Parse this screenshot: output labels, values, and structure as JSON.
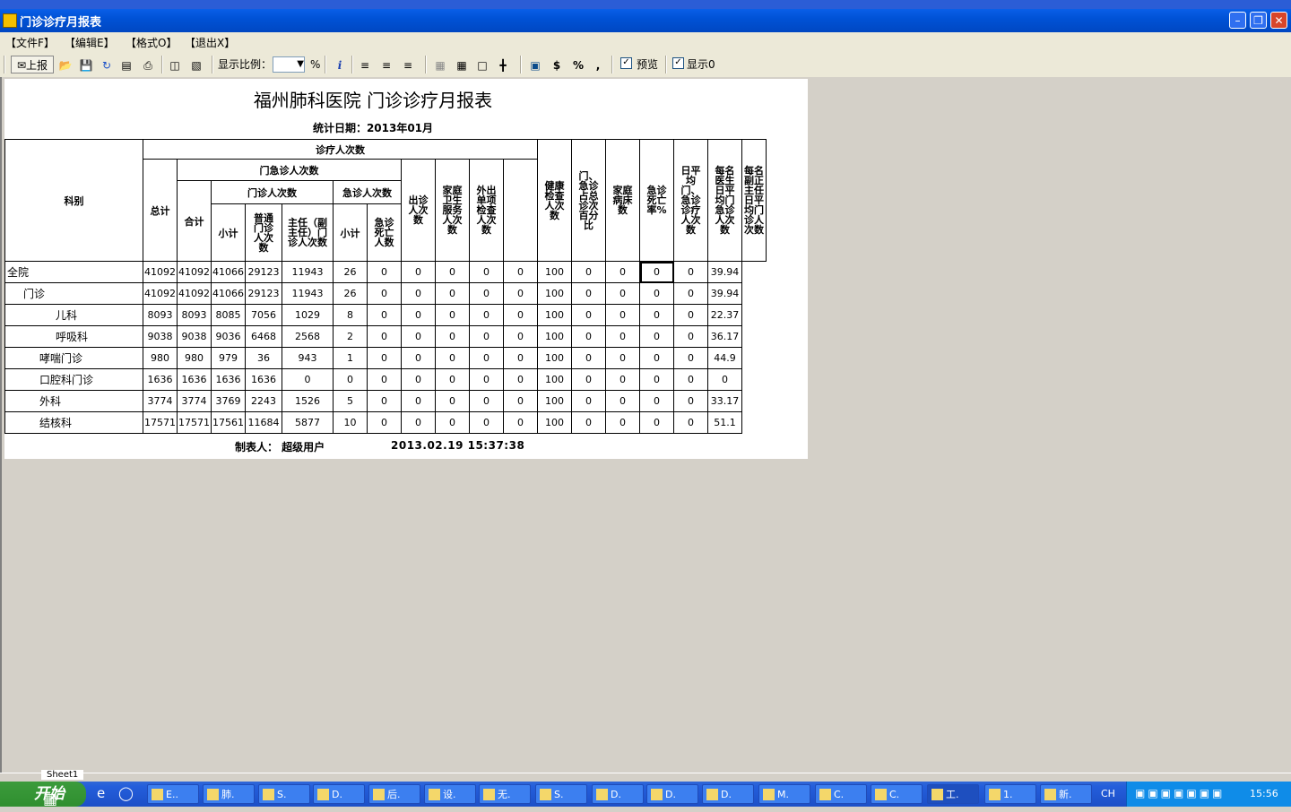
{
  "window": {
    "title": "门诊诊疗月报表"
  },
  "menu": {
    "file": "【文件F】",
    "edit": "【编辑E】",
    "format": "【格式O】",
    "exit": "【退出X】"
  },
  "toolbar": {
    "report": "上报",
    "zoom_label": "显示比例：",
    "zoom_value": "",
    "percent": "%",
    "preview": "预览",
    "show": "显示0",
    "dollar": "$",
    "pct": "%",
    "comma": ","
  },
  "report": {
    "title": "福州肺科医院  门诊诊疗月报表",
    "date": "统计日期：2013年01月",
    "headers": {
      "dept": "科别",
      "visits": "诊疗人次数",
      "total": "总计",
      "oe": "门急诊人次数",
      "oe_total": "合计",
      "outpatient": "门诊人次数",
      "op_sub": "小计",
      "op_general": "普通门诊人次数",
      "op_director": "主任（副主任）门诊人次数",
      "emergency": "急诊人次数",
      "em_sub": "小计",
      "em_death": "急诊死亡人数",
      "house_call": "出诊人次数",
      "family_service": "家庭卫生服务人次数",
      "external_exam": "外出单项检查人次数",
      "health_check": "健康检查人次数",
      "oe_ratio": "门、急诊占总诊次百分比",
      "family_beds": "家庭病床数",
      "em_death_rate": "急诊死亡率%",
      "daily_avg": "日平均门、急诊诊疗人次数",
      "doctor_daily": "每名医生日平均门急诊人次数",
      "director_daily": "每名副正主任日平均门诊人次数"
    },
    "rows": [
      {
        "name": "全院",
        "indent": 0,
        "v": [
          "41092",
          "41092",
          "41066",
          "29123",
          "11943",
          "26",
          "0",
          "0",
          "0",
          "0",
          "0",
          "100",
          "0",
          "0",
          "0",
          "0",
          "39.94"
        ]
      },
      {
        "name": "门诊",
        "indent": 1,
        "v": [
          "41092",
          "41092",
          "41066",
          "29123",
          "11943",
          "26",
          "0",
          "0",
          "0",
          "0",
          "0",
          "100",
          "0",
          "0",
          "0",
          "0",
          "39.94"
        ]
      },
      {
        "name": "儿科",
        "indent": 3,
        "v": [
          "8093",
          "8093",
          "8085",
          "7056",
          "1029",
          "8",
          "0",
          "0",
          "0",
          "0",
          "0",
          "100",
          "0",
          "0",
          "0",
          "0",
          "22.37"
        ]
      },
      {
        "name": "呼吸科",
        "indent": 3,
        "v": [
          "9038",
          "9038",
          "9036",
          "6468",
          "2568",
          "2",
          "0",
          "0",
          "0",
          "0",
          "0",
          "100",
          "0",
          "0",
          "0",
          "0",
          "36.17"
        ]
      },
      {
        "name": "哮喘门诊",
        "indent": 2,
        "v": [
          "980",
          "980",
          "979",
          "36",
          "943",
          "1",
          "0",
          "0",
          "0",
          "0",
          "0",
          "100",
          "0",
          "0",
          "0",
          "0",
          "44.9"
        ]
      },
      {
        "name": "口腔科门诊",
        "indent": 2,
        "v": [
          "1636",
          "1636",
          "1636",
          "1636",
          "0",
          "0",
          "0",
          "0",
          "0",
          "0",
          "0",
          "100",
          "0",
          "0",
          "0",
          "0",
          "0"
        ]
      },
      {
        "name": "外科",
        "indent": 2,
        "v": [
          "3774",
          "3774",
          "3769",
          "2243",
          "1526",
          "5",
          "0",
          "0",
          "0",
          "0",
          "0",
          "100",
          "0",
          "0",
          "0",
          "0",
          "33.17"
        ]
      },
      {
        "name": "结核科",
        "indent": 2,
        "v": [
          "17571",
          "17571",
          "17561",
          "11684",
          "5877",
          "10",
          "0",
          "0",
          "0",
          "0",
          "0",
          "100",
          "0",
          "0",
          "0",
          "0",
          "51.1"
        ]
      }
    ],
    "footer_maker": "制表人： 超级用户",
    "footer_time": "2013.02.19  15:37:38"
  },
  "sheet_tab": "Sheet1",
  "taskbar": {
    "start": "开始",
    "tasks": [
      "E..",
      "肺.",
      "S.",
      "D.",
      "后.",
      "设.",
      "无.",
      "S.",
      "D.",
      "D.",
      "D.",
      "M.",
      "C.",
      "C.",
      "工.",
      "1.",
      "新."
    ],
    "lang": "CH",
    "clock": "15:56"
  }
}
